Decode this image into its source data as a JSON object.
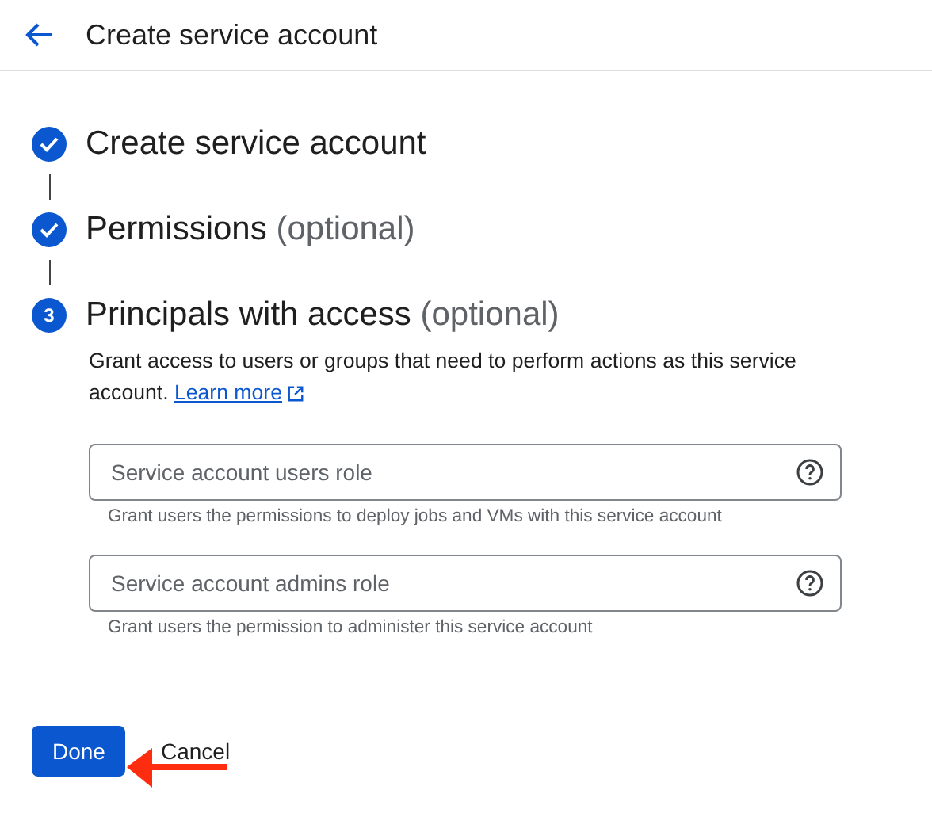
{
  "header": {
    "title": "Create service account"
  },
  "steps": [
    {
      "label": "Create service account",
      "completed": true
    },
    {
      "label": "Permissions",
      "optional": "(optional)",
      "completed": true
    },
    {
      "label": "Principals with access",
      "optional": "(optional)",
      "number": "3",
      "completed": false
    }
  ],
  "description": {
    "text": "Grant access to users or groups that need to perform actions as this service account.",
    "link": "Learn more"
  },
  "fields": [
    {
      "placeholder": "Service account users role",
      "hint": "Grant users the permissions to deploy jobs and VMs with this service account"
    },
    {
      "placeholder": "Service account admins role",
      "hint": "Grant users the permission to administer this service account"
    }
  ],
  "buttons": {
    "primary": "Done",
    "secondary": "Cancel"
  }
}
